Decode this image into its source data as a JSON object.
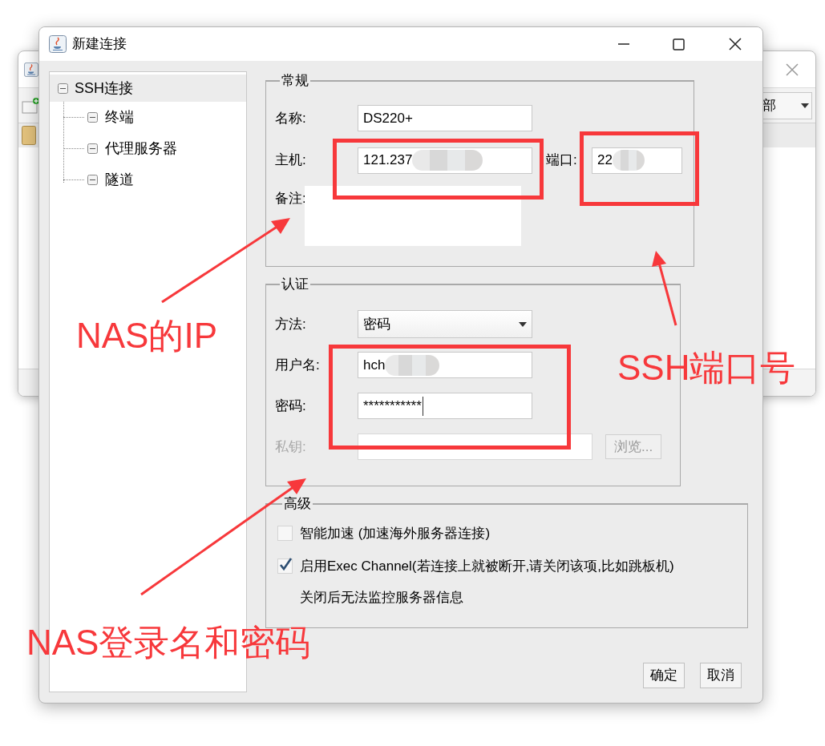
{
  "background_window": {
    "filter_value": "部"
  },
  "dialog": {
    "title": "新建连接"
  },
  "tree": [
    {
      "label": "SSH连接",
      "selected": true,
      "children": [
        {
          "label": "终端",
          "selected": false
        },
        {
          "label": "代理服务器",
          "selected": false
        },
        {
          "label": "隧道",
          "selected": false
        }
      ]
    }
  ],
  "general": {
    "legend": "常规",
    "name": {
      "label": "名称:",
      "value": "DS220+"
    },
    "host": {
      "label": "主机:",
      "value": "121.237",
      "blurred": true
    },
    "port": {
      "label": "端口:",
      "value": "22",
      "blurred": true
    },
    "note": {
      "label": "备注:"
    }
  },
  "auth": {
    "legend": "认证",
    "method": {
      "label": "方法:",
      "value": "密码"
    },
    "username": {
      "label": "用户名:",
      "value": "hch",
      "blurred": true
    },
    "password": {
      "label": "密码:",
      "value": "***********"
    },
    "private_key": {
      "label": "私钥:",
      "disabled": true
    },
    "browse_button": {
      "label": "浏览...",
      "disabled": true
    }
  },
  "advanced": {
    "legend": "高级",
    "options": [
      {
        "label": "智能加速 (加速海外服务器连接)",
        "checked": false
      },
      {
        "label": "启用Exec Channel(若连接上就被断开,请关闭该项,比如跳板机)",
        "checked": true
      }
    ],
    "note": "关闭后无法监控服务器信息"
  },
  "buttons": [
    "确定",
    "取消"
  ],
  "annotations": [
    {
      "label": "NAS的IP"
    },
    {
      "label": "SSH端口号"
    },
    {
      "label": "NAS登录名和密码"
    }
  ]
}
